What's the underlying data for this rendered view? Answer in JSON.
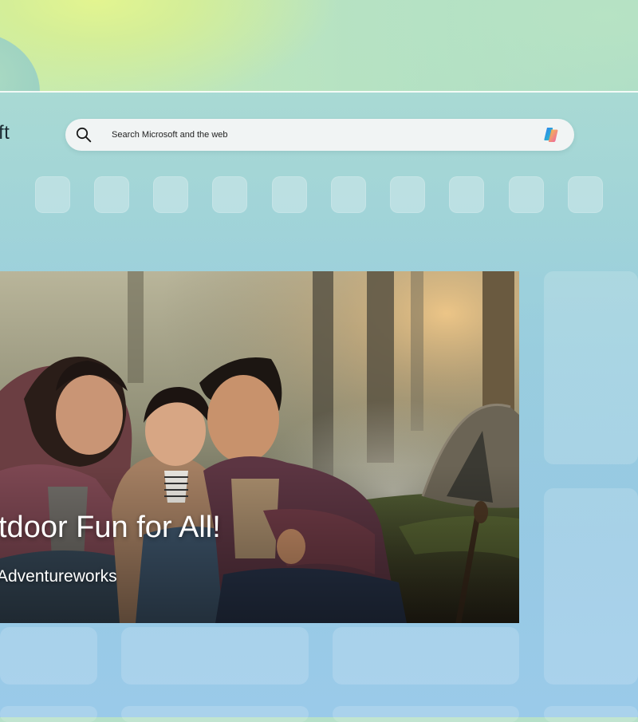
{
  "header": {
    "logo_text": "ft"
  },
  "search": {
    "placeholder": "Search Microsoft and the web",
    "value": ""
  },
  "icons": {
    "search": "search-icon",
    "copilot": "copilot-icon"
  },
  "quick_links_count": 10,
  "hero": {
    "title": "tdoor Fun for All!",
    "subtitle": "Adventureworks"
  },
  "colors": {
    "page_background": "#9ccfda",
    "search_background": "#f4f6f5",
    "copilot_gradient": [
      "#2f7cf6",
      "#f7b936",
      "#e64fa6"
    ]
  }
}
